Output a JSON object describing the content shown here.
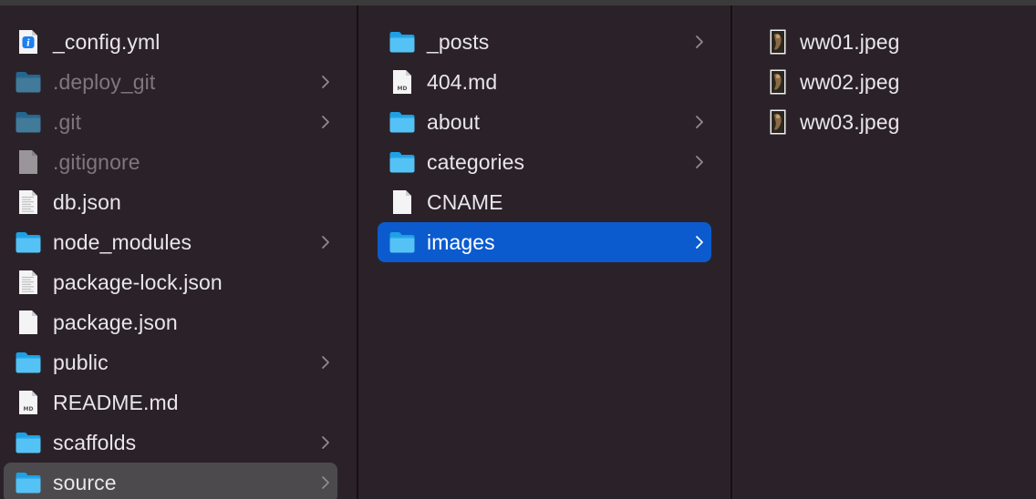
{
  "colors": {
    "background": "#2b2229",
    "folder_light": "#55c2f5",
    "folder_dark": "#1ea0e4",
    "selection_active": "#0b5bcf",
    "selection_inactive": "#4c4a4d",
    "text": "#e8e6e8",
    "hidden_text": "#7d787c"
  },
  "columns": [
    {
      "items": [
        {
          "name": "_config.yml",
          "kind": "yml-file-icon",
          "folder": false,
          "hidden": false
        },
        {
          "name": ".deploy_git",
          "kind": "folder-icon",
          "folder": true,
          "hidden": true
        },
        {
          "name": ".git",
          "kind": "folder-icon",
          "folder": true,
          "hidden": true
        },
        {
          "name": ".gitignore",
          "kind": "document-icon",
          "folder": false,
          "hidden": true
        },
        {
          "name": "db.json",
          "kind": "json-file-icon",
          "folder": false,
          "hidden": false
        },
        {
          "name": "node_modules",
          "kind": "folder-icon",
          "folder": true,
          "hidden": false
        },
        {
          "name": "package-lock.json",
          "kind": "json-file-icon",
          "folder": false,
          "hidden": false
        },
        {
          "name": "package.json",
          "kind": "document-icon",
          "folder": false,
          "hidden": false
        },
        {
          "name": "public",
          "kind": "folder-icon",
          "folder": true,
          "hidden": false
        },
        {
          "name": "README.md",
          "kind": "md-file-icon",
          "folder": false,
          "hidden": false
        },
        {
          "name": "scaffolds",
          "kind": "folder-icon",
          "folder": true,
          "hidden": false
        },
        {
          "name": "source",
          "kind": "folder-icon",
          "folder": true,
          "hidden": false,
          "selected": "inactive"
        }
      ]
    },
    {
      "items": [
        {
          "name": "_posts",
          "kind": "folder-icon",
          "folder": true,
          "hidden": false
        },
        {
          "name": "404.md",
          "kind": "md-file-icon",
          "folder": false,
          "hidden": false
        },
        {
          "name": "about",
          "kind": "folder-icon",
          "folder": true,
          "hidden": false
        },
        {
          "name": "categories",
          "kind": "folder-icon",
          "folder": true,
          "hidden": false
        },
        {
          "name": "CNAME",
          "kind": "document-icon",
          "folder": false,
          "hidden": false
        },
        {
          "name": "images",
          "kind": "folder-icon",
          "folder": true,
          "hidden": false,
          "selected": "active"
        }
      ]
    },
    {
      "items": [
        {
          "name": "ww01.jpeg",
          "kind": "image-thumbnail-icon",
          "folder": false,
          "hidden": false
        },
        {
          "name": "ww02.jpeg",
          "kind": "image-thumbnail-icon",
          "folder": false,
          "hidden": false
        },
        {
          "name": "ww03.jpeg",
          "kind": "image-thumbnail-icon",
          "folder": false,
          "hidden": false
        }
      ]
    }
  ]
}
